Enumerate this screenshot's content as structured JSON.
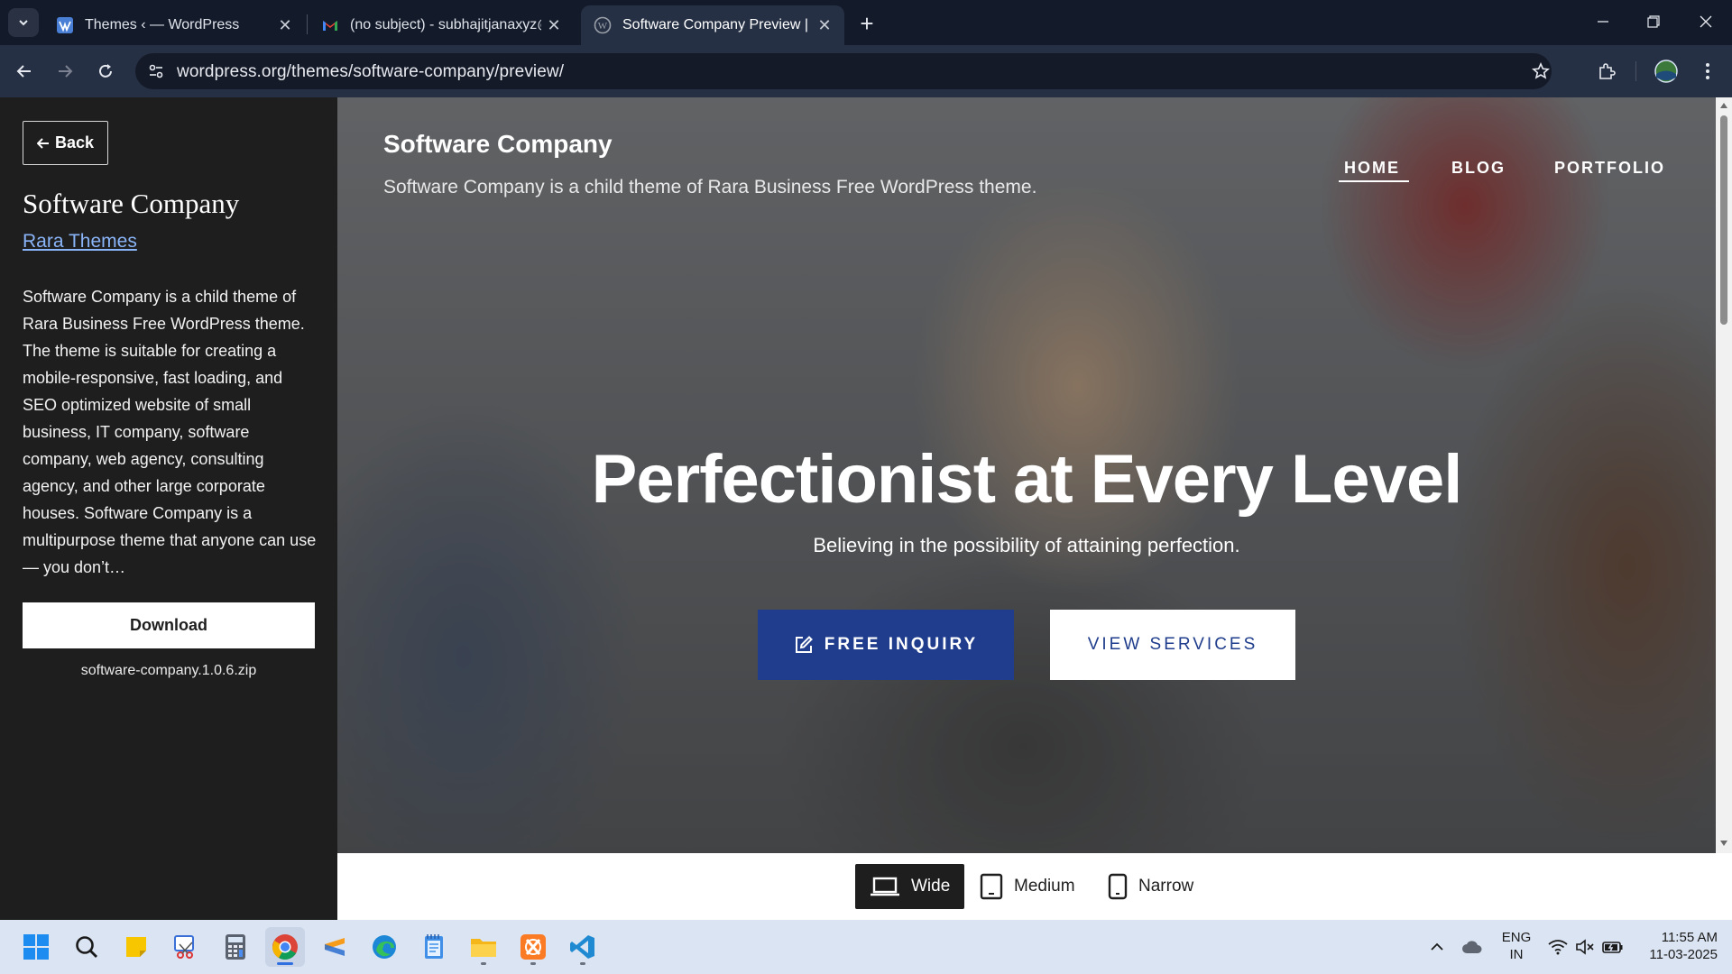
{
  "browser": {
    "tabs": [
      {
        "title": "Themes ‹ — WordPress",
        "icon": "wordpress-admin-icon",
        "active": false
      },
      {
        "title": "(no subject) - subhajitjanaxyz@",
        "icon": "gmail-icon",
        "active": false
      },
      {
        "title": "Software Company Preview | W",
        "icon": "wordpress-icon",
        "active": true
      }
    ],
    "url": "wordpress.org/themes/software-company/preview/",
    "new_tab_label": "+",
    "close_glyph": "✕"
  },
  "panel": {
    "back_label": "Back",
    "theme_name": "Software Company",
    "author": "Rara Themes",
    "description": "Software Company is a child theme of Rara Business Free WordPress theme. The theme is suitable for creating a mobile-responsive, fast loading, and SEO optimized website of small business, IT company, software company, web agency, consulting agency, and other large corporate houses. Software Company is a multipurpose theme that anyone can use — you don’t…",
    "download_label": "Download",
    "zip_name": "software-company.1.0.6.zip"
  },
  "preview": {
    "site_title": "Software Company",
    "tagline": "Software Company is a child theme of Rara Business Free WordPress theme.",
    "nav": [
      "HOME",
      "BLOG",
      "PORTFOLIO"
    ],
    "hero_title": "Perfectionist at Every Level",
    "hero_subtitle": "Believing in the possibility of attaining perfection.",
    "primary_button": "FREE INQUIRY",
    "secondary_button": "VIEW SERVICES",
    "accent_color": "#1f3d8c"
  },
  "devices": {
    "wide": "Wide",
    "medium": "Medium",
    "narrow": "Narrow",
    "selected": "Wide"
  },
  "taskbar": {
    "apps": [
      "start-icon",
      "search-icon",
      "sticky-notes-icon",
      "snipping-tool-icon",
      "calculator-icon",
      "chrome-icon",
      "sublime-icon",
      "edge-icon",
      "notepad-icon",
      "file-explorer-icon",
      "xampp-icon",
      "vscode-icon"
    ],
    "lang_top": "ENG",
    "lang_bottom": "IN",
    "time": "11:55 AM",
    "date": "11-03-2025"
  }
}
